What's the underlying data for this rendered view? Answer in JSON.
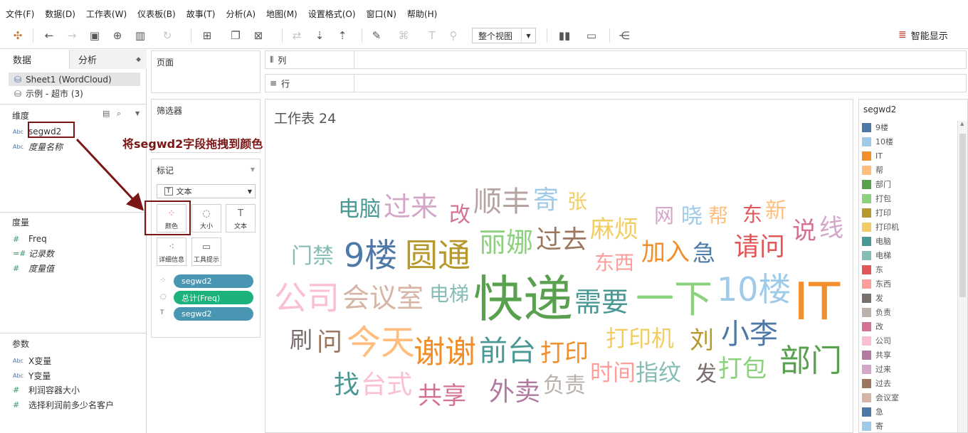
{
  "menu": [
    "文件(F)",
    "数据(D)",
    "工作表(W)",
    "仪表板(B)",
    "故事(T)",
    "分析(A)",
    "地图(M)",
    "设置格式(O)",
    "窗口(N)",
    "帮助(H)"
  ],
  "toolbar": {
    "view_fit": "整个视图",
    "smart_show": "智能显示"
  },
  "left": {
    "tab_data": "数据",
    "tab_analysis": "分析",
    "datasources": [
      "Sheet1 (WordCloud)",
      "示例 - 超市 (3)"
    ],
    "dimensions_header": "维度",
    "dimensions": [
      "segwd2",
      "度量名称"
    ],
    "measures_header": "度量",
    "measures": [
      "Freq",
      "记录数",
      "度量值"
    ],
    "params_header": "参数",
    "params": [
      "X变量",
      "Y变量",
      "利润容器大小",
      "选择利润前多少名客户"
    ]
  },
  "shelves": {
    "pages": "页面",
    "filters": "筛选器",
    "marks": "标记",
    "columns": "列",
    "rows": "行"
  },
  "marks": {
    "type": "文本",
    "color": "颜色",
    "size": "大小",
    "text": "文本",
    "detail": "详细信息",
    "tooltip": "工具提示",
    "pills": [
      "segwd2",
      "总计(Freq)",
      "segwd2"
    ]
  },
  "annotation": "将segwd2字段拖拽到颜色",
  "worksheet_title": "工作表 24",
  "legend": {
    "title": "segwd2",
    "items": [
      {
        "label": "9楼",
        "color": "#4e79a7"
      },
      {
        "label": "10楼",
        "color": "#a0cbe8"
      },
      {
        "label": "IT",
        "color": "#f28e2b"
      },
      {
        "label": "帮",
        "color": "#ffbe7d"
      },
      {
        "label": "部门",
        "color": "#59a14f"
      },
      {
        "label": "打包",
        "color": "#8cd17d"
      },
      {
        "label": "打印",
        "color": "#b6992d"
      },
      {
        "label": "打印机",
        "color": "#f1ce63"
      },
      {
        "label": "电脑",
        "color": "#499894"
      },
      {
        "label": "电梯",
        "color": "#86bcb6"
      },
      {
        "label": "东",
        "color": "#e15759"
      },
      {
        "label": "东西",
        "color": "#ff9d9a"
      },
      {
        "label": "发",
        "color": "#79706e"
      },
      {
        "label": "负责",
        "color": "#bab0ac"
      },
      {
        "label": "改",
        "color": "#d37295"
      },
      {
        "label": "公司",
        "color": "#fabfd2"
      },
      {
        "label": "共享",
        "color": "#b07aa1"
      },
      {
        "label": "过来",
        "color": "#d4a6c8"
      },
      {
        "label": "过去",
        "color": "#9d7660"
      },
      {
        "label": "会议室",
        "color": "#d7b5a6"
      },
      {
        "label": "急",
        "color": "#4e79a7"
      },
      {
        "label": "寄",
        "color": "#a0cbe8"
      }
    ]
  },
  "words": [
    {
      "text": "电脑",
      "color": "#499894"
    },
    {
      "text": "过来",
      "color": "#d4a6c8"
    },
    {
      "text": "改",
      "color": "#d37295"
    },
    {
      "text": "顺丰",
      "color": "#b6a2a0"
    },
    {
      "text": "寄",
      "color": "#a0cbe8"
    },
    {
      "text": "张",
      "color": "#f1ce63"
    },
    {
      "text": "网",
      "color": "#d4a6c8"
    },
    {
      "text": "晓",
      "color": "#a0cbe8"
    },
    {
      "text": "帮",
      "color": "#ffbe7d"
    },
    {
      "text": "东",
      "color": "#e15759"
    },
    {
      "text": "新",
      "color": "#ffbe7d"
    },
    {
      "text": "说",
      "color": "#d37295"
    },
    {
      "text": "线",
      "color": "#d4a6c8"
    },
    {
      "text": "门禁",
      "color": "#86bcb6"
    },
    {
      "text": "9楼",
      "color": "#4e79a7"
    },
    {
      "text": "圆通",
      "color": "#b6992d"
    },
    {
      "text": "丽娜",
      "color": "#8cd17d"
    },
    {
      "text": "过去",
      "color": "#9d7660"
    },
    {
      "text": "麻烦",
      "color": "#f1ce63"
    },
    {
      "text": "东西",
      "color": "#ff9d9a"
    },
    {
      "text": "加入",
      "color": "#f28e2b"
    },
    {
      "text": "急",
      "color": "#4e79a7"
    },
    {
      "text": "请问",
      "color": "#e15759"
    },
    {
      "text": "公司",
      "color": "#fabfd2"
    },
    {
      "text": "会议室",
      "color": "#d7b5a6"
    },
    {
      "text": "电梯",
      "color": "#86bcb6"
    },
    {
      "text": "快递",
      "color": "#59a14f"
    },
    {
      "text": "需要",
      "color": "#499894"
    },
    {
      "text": "一下",
      "color": "#8cd17d"
    },
    {
      "text": "10楼",
      "color": "#a0cbe8"
    },
    {
      "text": "IT",
      "color": "#f28e2b"
    },
    {
      "text": "刷",
      "color": "#79706e"
    },
    {
      "text": "问",
      "color": "#9d7660"
    },
    {
      "text": "今天",
      "color": "#ffbe7d"
    },
    {
      "text": "谢谢",
      "color": "#f28e2b"
    },
    {
      "text": "前台",
      "color": "#499894"
    },
    {
      "text": "打印",
      "color": "#f28e2b"
    },
    {
      "text": "打印机",
      "color": "#f1ce63"
    },
    {
      "text": "刘",
      "color": "#b6992d"
    },
    {
      "text": "小李",
      "color": "#4e79a7"
    },
    {
      "text": "找",
      "color": "#499894"
    },
    {
      "text": "台式",
      "color": "#fabfd2"
    },
    {
      "text": "共享",
      "color": "#d37295"
    },
    {
      "text": "外卖",
      "color": "#b07aa1"
    },
    {
      "text": "负责",
      "color": "#bab0ac"
    },
    {
      "text": "时间",
      "color": "#ff9d9a"
    },
    {
      "text": "指纹",
      "color": "#86bcb6"
    },
    {
      "text": "发",
      "color": "#79706e"
    },
    {
      "text": "打包",
      "color": "#8cd17d"
    },
    {
      "text": "部门",
      "color": "#59a14f"
    }
  ]
}
